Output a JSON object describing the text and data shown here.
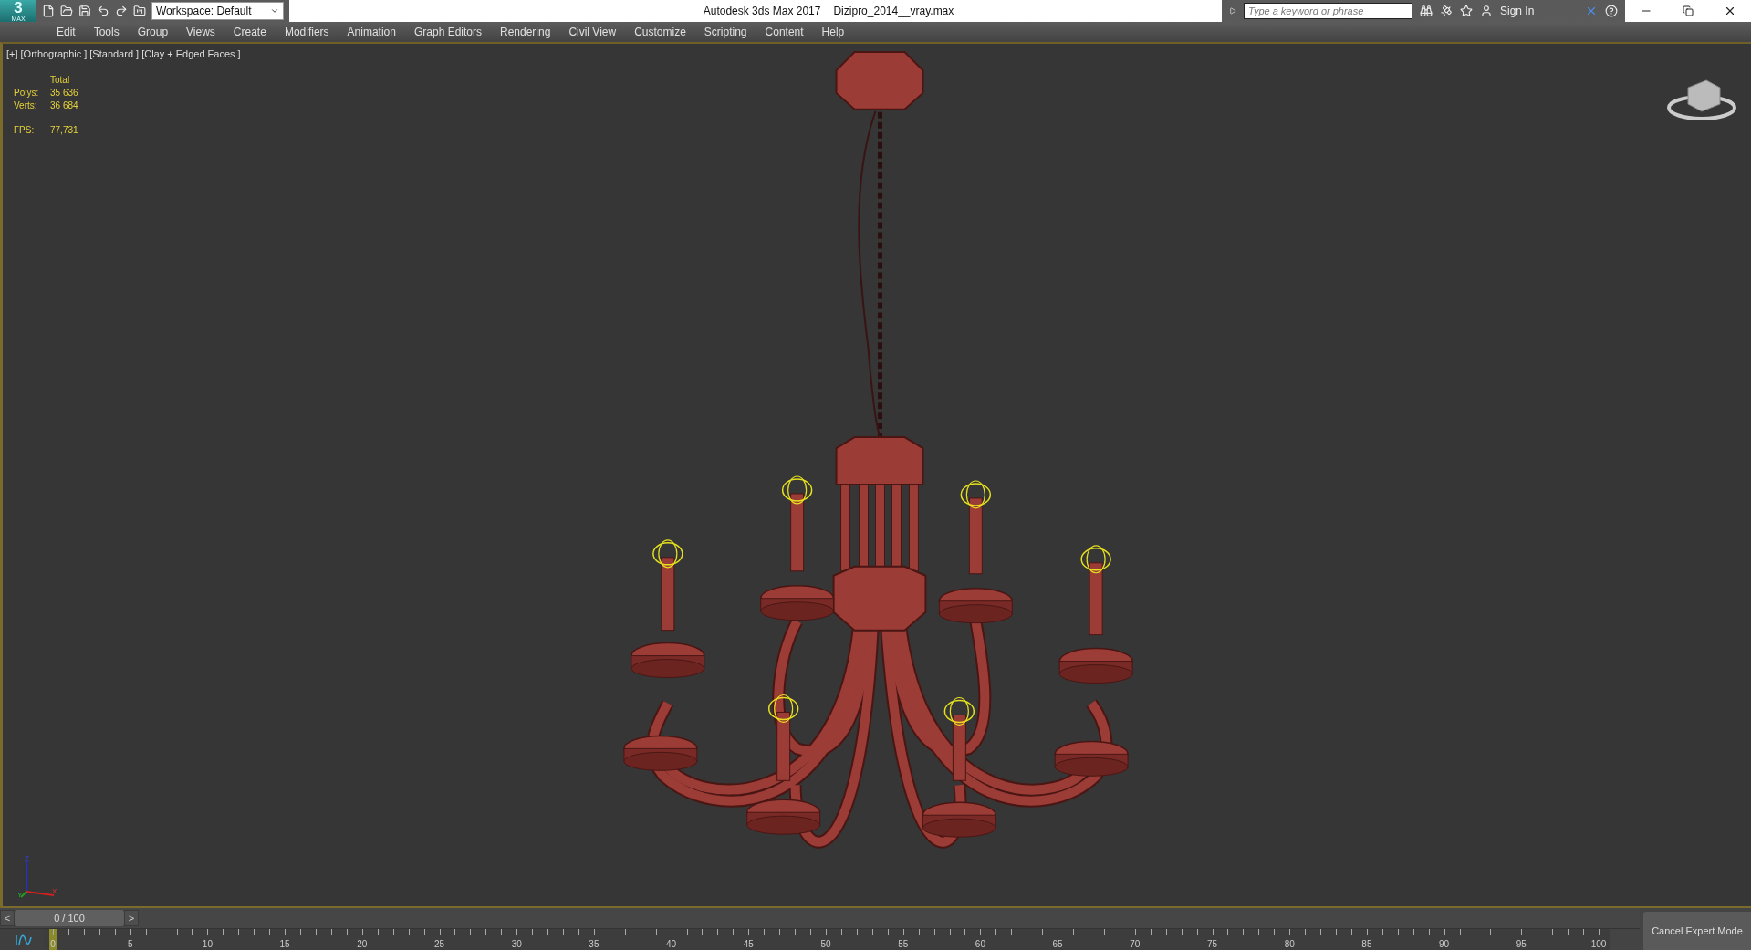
{
  "logo": {
    "mark": "3",
    "sub": "MAX"
  },
  "workspace": {
    "label": "Workspace: Default"
  },
  "title": {
    "app": "Autodesk 3ds Max 2017",
    "file": "Dizipro_2014__vray.max"
  },
  "search": {
    "placeholder": "Type a keyword or phrase"
  },
  "sign_in": "Sign In",
  "menu": [
    "Edit",
    "Tools",
    "Group",
    "Views",
    "Create",
    "Modifiers",
    "Animation",
    "Graph Editors",
    "Rendering",
    "Civil View",
    "Customize",
    "Scripting",
    "Content",
    "Help"
  ],
  "viewport": {
    "labels": [
      "[+]",
      "[Orthographic ]",
      "[Standard ]",
      "[Clay + Edged Faces ]"
    ],
    "stats": {
      "header": "Total",
      "rows": [
        {
          "label": "Polys:",
          "value": "35 636"
        },
        {
          "label": "Verts:",
          "value": "36 684"
        }
      ],
      "fps_label": "FPS:",
      "fps": "77,731"
    },
    "axes": [
      "Z",
      "Y",
      "X"
    ]
  },
  "time_slider": {
    "prev": "<",
    "frame": "0 / 100",
    "next": ">"
  },
  "track": {
    "ticks": [
      "0",
      "5",
      "10",
      "15",
      "20",
      "25",
      "30",
      "35",
      "40",
      "45",
      "50",
      "55",
      "60",
      "65",
      "70",
      "75",
      "80",
      "85",
      "90",
      "95",
      "100"
    ]
  },
  "expert_button": "Cancel Expert Mode"
}
